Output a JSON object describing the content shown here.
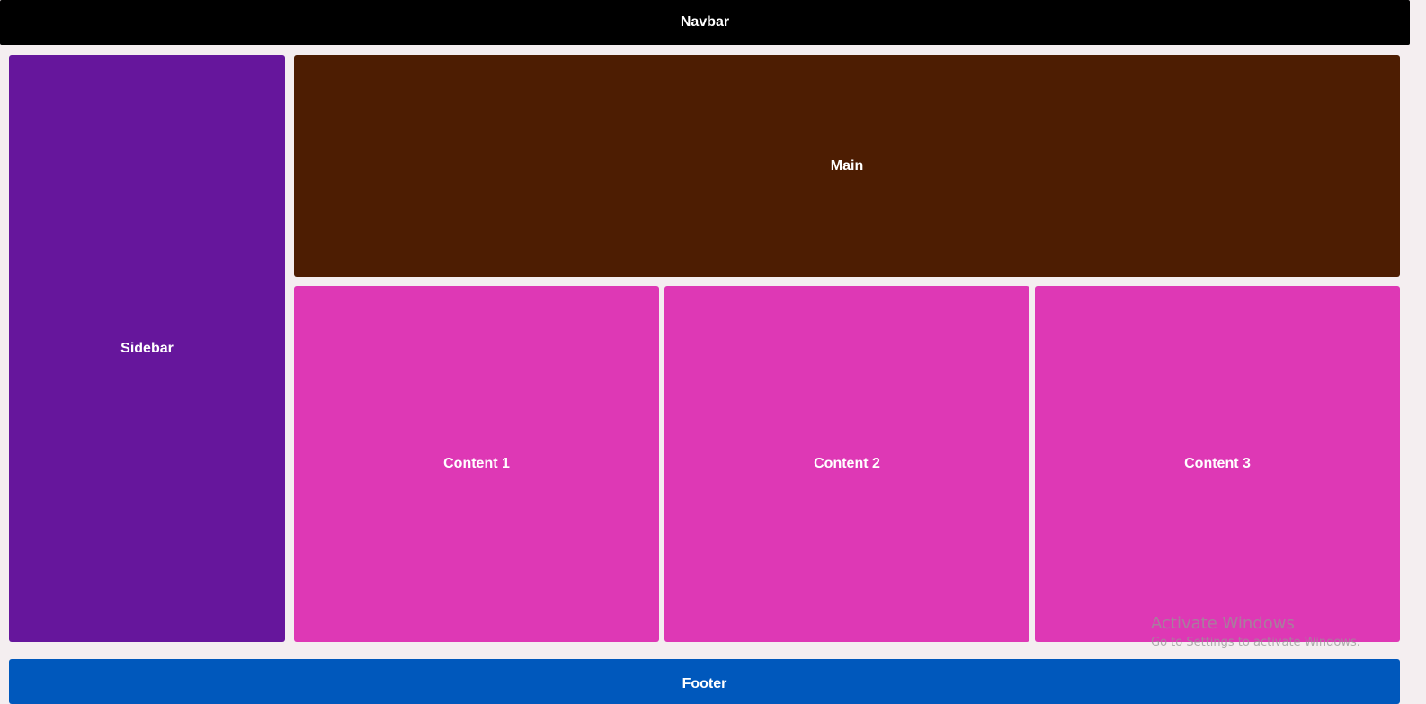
{
  "layout": {
    "navbar": {
      "label": "Navbar",
      "color": "#000000"
    },
    "sidebar": {
      "label": "Sidebar",
      "color": "#66169c"
    },
    "main": {
      "label": "Main",
      "color": "#4d1d02"
    },
    "contents": [
      {
        "label": "Content 1",
        "color": "#de38b5"
      },
      {
        "label": "Content 2",
        "color": "#de38b5"
      },
      {
        "label": "Content 3",
        "color": "#de38b5"
      }
    ],
    "footer": {
      "label": "Footer",
      "color": "#0058bc"
    }
  },
  "background_color": "#f4eef0",
  "os_watermark": {
    "title": "Activate Windows",
    "subtitle": "Go to Settings to activate Windows."
  }
}
